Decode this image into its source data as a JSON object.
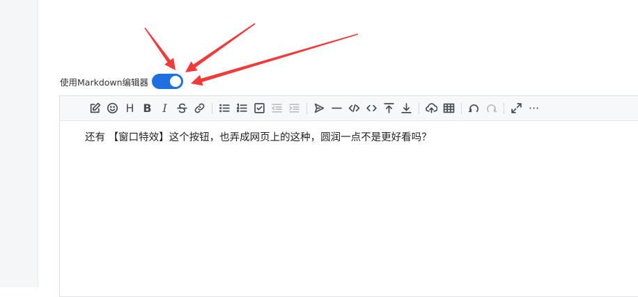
{
  "settings": {
    "markdown_toggle_label": "使用Markdown编辑器",
    "markdown_toggle_on": true,
    "accent_color": "#1e6fe0"
  },
  "annotation_color": "#f23a3a",
  "toolbar": {
    "icons": [
      "edit-icon",
      "emoji-icon",
      "heading-icon",
      "bold-icon",
      "italic-icon",
      "strikethrough-icon",
      "link-icon",
      "unordered-list-icon",
      "ordered-list-icon",
      "checklist-icon",
      "outdent-icon",
      "indent-icon",
      "quote-icon",
      "horizontal-rule-icon",
      "code-icon",
      "inline-code-icon",
      "insert-before-icon",
      "insert-after-icon",
      "upload-icon",
      "table-icon",
      "undo-icon",
      "redo-icon",
      "fullscreen-icon",
      "more-icon"
    ],
    "heading_glyph": "H",
    "bold_glyph": "B",
    "italic_glyph": "I",
    "more_glyph": "···"
  },
  "editor": {
    "content": "还有 【窗口特效】这个按钮，也弄成网页上的这种，圆润一点不是更好看吗？"
  }
}
